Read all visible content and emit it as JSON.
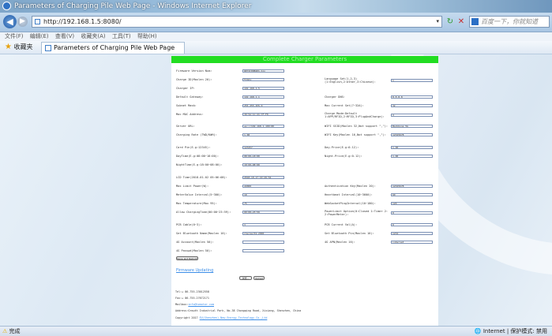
{
  "window": {
    "title": "Parameters of Charging Pile Web Page - Windows Internet Explorer"
  },
  "nav": {
    "url": "http://192.168.1.5:8080/",
    "search_placeholder": "百度一下，你就知道"
  },
  "menubar": {
    "items": [
      "文件(F)",
      "编辑(E)",
      "查看(V)",
      "收藏夹(A)",
      "工具(T)",
      "帮助(H)"
    ]
  },
  "favorites": {
    "label": "收藏夹",
    "tab_title": "Parameters of Charging Pile Web Page"
  },
  "page": {
    "header": "Complete Charger Parameters",
    "fields": {
      "firmware_version": {
        "label": "Firmware Version Num:",
        "value": "W072C00B201.bin"
      },
      "charge_id": {
        "label": "Charge ID(Maxlen 20):",
        "value": "FV101"
      },
      "charger_ip": {
        "label": "Charger IP:",
        "value": "192.168.1.5"
      },
      "default_gateway": {
        "label": "Default Gateway:",
        "value": "192.168.1.1"
      },
      "subnet_mask": {
        "label": "Subnet Mask:",
        "value": "255.255.255.0"
      },
      "mac_address": {
        "label": "Mac MAC Address:",
        "value": "30:5A:1C:21:7F:F0"
      },
      "server_url": {
        "label": "Server URL:",
        "value": "ws://192.168.1.100:80"
      },
      "charging_rate": {
        "label": "Charging Rate (TWD/KWH):",
        "value": "1.00"
      },
      "language": {
        "label": "Language Set(1,2,3)",
        "label2": "(1:English,2:Other,3:Chinese):",
        "value": "1"
      },
      "charger_dns": {
        "label": "Charger DNS:",
        "value": "8.8.8.8"
      },
      "max_current": {
        "label": "Max Current Set(7~32A):",
        "value": "32"
      },
      "charge_mode": {
        "label": "Charge Mode:Default",
        "label2": "1:APP/RFID,2:RFID,3:PlugAndCharge):",
        "value": "3"
      },
      "wifi_ssid": {
        "label": "WIFI SSID(Maxlen 32,Not support \",\"):",
        "value": "Backbone_5G"
      },
      "wifi_key": {
        "label": "WIFI Key(Maxlen 16,Not support \",\"):",
        "value": "12345678"
      },
      "card_pin": {
        "label": "Card Pin(E.g:12345):",
        "value": "123457"
      },
      "daytime": {
        "label": "DayTime(E.g:08:00~18:00):",
        "value": "08:00~18:00"
      },
      "nighttime": {
        "label": "NightTime(E.g:18:00~08:00):",
        "value": "18:00~08:00"
      },
      "day_price": {
        "label": "Day-Price(E.g:0.12):",
        "value": "1.00"
      },
      "night_price": {
        "label": "Night-Price(E.g:0.12):",
        "value": "1.00"
      },
      "lcd_time": {
        "label": "LCD Time(2018-01-02 05:06:08):",
        "value": "2018-10-17 10:26:54"
      },
      "max_limit_power": {
        "label": "Max Limit Power(W):",
        "value": "22000"
      },
      "metervalue_interval": {
        "label": "MeterValue Interval(5~300):",
        "value": "10"
      },
      "max_temperature": {
        "label": "Max Temperature(Max 95):",
        "value": "75"
      },
      "allow_charging_time": {
        "label": "Allow ChargingTime(00:00~23:59):",
        "value": "00:00~23:59"
      },
      "auth_key": {
        "label": "Authentication Key(Maxlen 20):",
        "value": "12345678"
      },
      "heartbeat_interval": {
        "label": "Heartbeat Interval(10~3600):",
        "value": "60"
      },
      "websocket_ping": {
        "label": "WebSocketPingInterval(10~180):",
        "value": "120"
      },
      "powerlimit_option": {
        "label": "PowerLimit Option(0:Closed 1:Timer 2:",
        "label2": "2:PowerMeter):",
        "value": "0"
      },
      "pcb_cable": {
        "label": "PCB Cable(0~3):",
        "value": "3"
      },
      "pcb_current_val": {
        "label": "PCB Current Val(A):",
        "value": "0"
      },
      "bluetooth_name": {
        "label": "Set Bluetooth Name(Maxlen 16):",
        "value": "Charger01_2000"
      },
      "bluetooth_pin": {
        "label": "Set Bluetooth Pin(Maxlen 16):",
        "value": "1234"
      },
      "g4_account": {
        "label": "4G Account(Maxlen 50):",
        "value": ""
      },
      "g4_apn": {
        "label": "4G APN(Maxlen 16):",
        "value": "internet"
      },
      "g4_passwd": {
        "label": "4G Passwd(Maxlen 50):",
        "value": ""
      }
    },
    "buttons": {
      "save_reboot": "Save and Reboot",
      "browse": "浏览...",
      "upload": "Upload"
    },
    "firmware_updating": "Firmware Updating",
    "footer": {
      "tel": "Tel:+ 86-755-23012558",
      "fax": "Fax:+ 86-755-27672171",
      "mailbox_prefix": "Mailbox:",
      "mailbox_value": "info@hcmotor.com",
      "address": "Address:Growth Industrial Park, No.38 Chongqing Road, Xixiang, Shenzhen, China",
      "copyright_prefix": "Copyright 2017 ",
      "copyright_value": "EV(Shenzhen) New Energy Technology Co.,Ltd"
    }
  },
  "status": {
    "left": "完成",
    "right": "Internet | 保护模式: 禁用"
  },
  "colors": {
    "header_green": "#22dd22",
    "link_blue": "#3c8ee8",
    "field_border": "#7a8fb3"
  }
}
